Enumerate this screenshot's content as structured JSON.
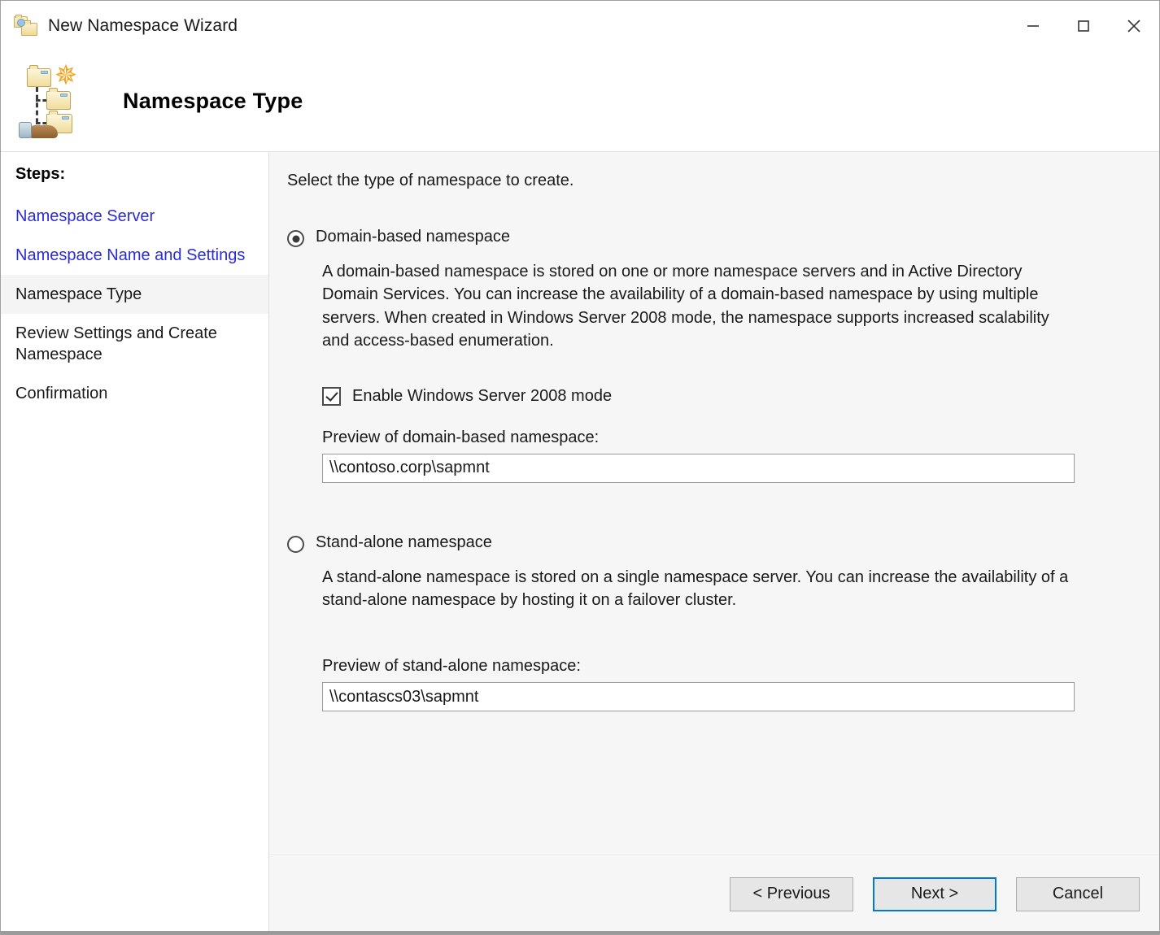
{
  "window": {
    "title": "New Namespace Wizard",
    "title_icon": "folders-icon",
    "controls": {
      "minimize": "minimize-icon",
      "maximize": "maximize-icon",
      "close": "close-icon"
    }
  },
  "header": {
    "title": "Namespace Type",
    "icon": "namespace-tree-wizard-icon"
  },
  "sidebar": {
    "heading": "Steps:",
    "items": [
      {
        "label": "Namespace Server",
        "state": "done"
      },
      {
        "label": "Namespace Name and Settings",
        "state": "done"
      },
      {
        "label": "Namespace Type",
        "state": "current"
      },
      {
        "label": "Review Settings and Create Namespace",
        "state": "pending"
      },
      {
        "label": "Confirmation",
        "state": "pending"
      }
    ]
  },
  "main": {
    "intro": "Select the type of namespace to create.",
    "options": [
      {
        "label": "Domain-based namespace",
        "selected": true,
        "description": "A domain-based namespace is stored on one or more namespace servers and in Active Directory Domain Services. You can increase the availability of a domain-based namespace by using multiple servers. When created in Windows Server 2008 mode, the namespace supports increased scalability and access-based enumeration.",
        "checkbox": {
          "label": "Enable Windows Server 2008 mode",
          "checked": true
        },
        "preview_label": "Preview of domain-based namespace:",
        "preview_value": "\\\\contoso.corp\\sapmnt"
      },
      {
        "label": "Stand-alone namespace",
        "selected": false,
        "description": "A stand-alone namespace is stored on a single namespace server. You can increase the availability of a stand-alone namespace by hosting it on a failover cluster.",
        "preview_label": "Preview of stand-alone namespace:",
        "preview_value": "\\\\contascs03\\sapmnt"
      }
    ]
  },
  "footer": {
    "previous": "< Previous",
    "next": "Next >",
    "cancel": "Cancel"
  },
  "colors": {
    "link": "#2b2bd8",
    "focus_border": "#0078d7",
    "panel_bg": "#f6f6f6",
    "sidebar_bg": "#ffffff",
    "current_step_bg": "#f4f4f4"
  }
}
